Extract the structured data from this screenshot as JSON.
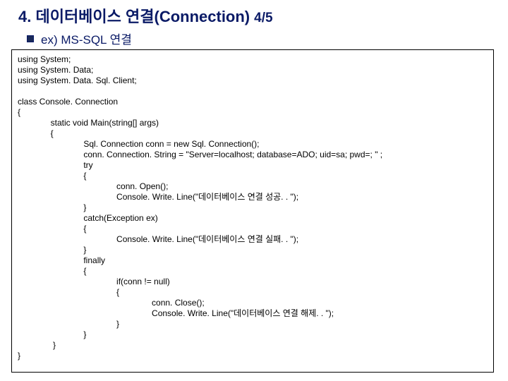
{
  "header": {
    "title": "4. 데이터베이스 연결(Connection)",
    "page": "4/5",
    "subtitle": "ex) MS-SQL 연결"
  },
  "code": "using System;\nusing System. Data;\nusing System. Data. Sql. Client;\n\nclass Console. Connection\n{\n              static void Main(string[] args)\n              {\n                            Sql. Connection conn = new Sql. Connection();\n                            conn. Connection. String = \"Server=localhost; database=ADO; uid=sa; pwd=; \" ;\n                            try\n                            {\n                                          conn. Open();\n                                          Console. Write. Line(\"데이터베이스 연결 성공. . \");\n                            }\n                            catch(Exception ex)\n                            {\n                                          Console. Write. Line(\"데이터베이스 연결 실패. . \");\n                            }\n                            finally\n                            {\n                                          if(conn != null)\n                                          {\n                                                         conn. Close();\n                                                         Console. Write. Line(\"데이터베이스 연결 해제. . \");\n                                          }\n                            }\n               }\n}"
}
